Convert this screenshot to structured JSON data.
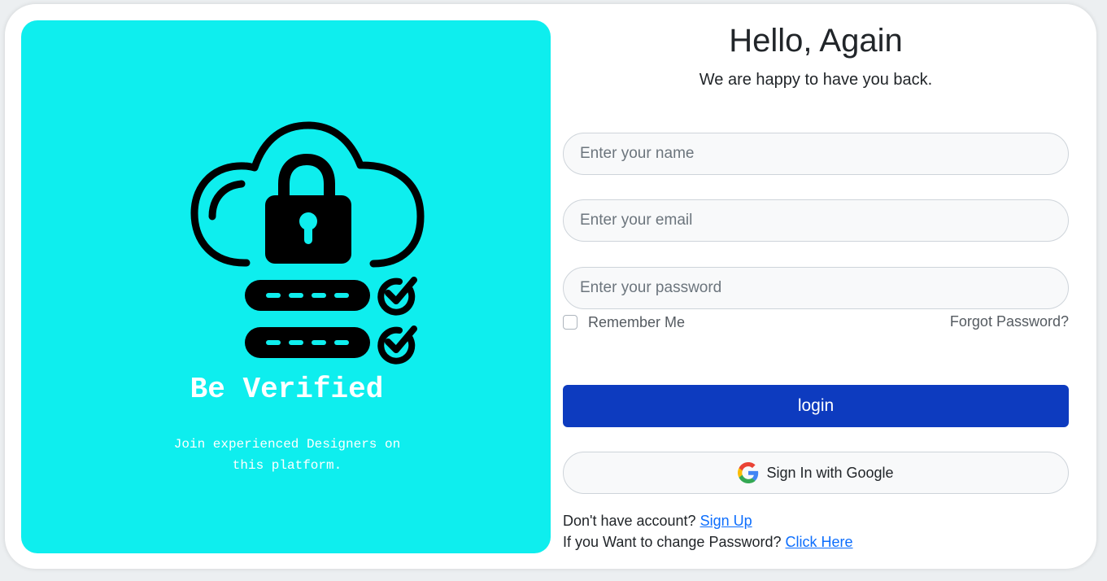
{
  "promo": {
    "title": "Be Verified",
    "text": "Join experienced Designers on this platform.",
    "icon": "cloud-lock-password-verified-icon"
  },
  "login": {
    "heading": "Hello, Again",
    "subheading": "We are happy to have you back.",
    "name_placeholder": "Enter your name",
    "email_placeholder": "Enter your email",
    "password_placeholder": "Enter your password",
    "remember_label": "Remember Me",
    "forgot_label": "Forgot Password?",
    "login_label": "login",
    "google_label": "Sign In with Google",
    "signup_prompt": "Don't have account?",
    "signup_link": "Sign Up",
    "change_prompt": "If you Want to change Password?",
    "change_link": "Click Here"
  },
  "colors": {
    "panel": "#0eeeee",
    "login_button": "#0d3bbf",
    "link": "#0d6efd"
  }
}
